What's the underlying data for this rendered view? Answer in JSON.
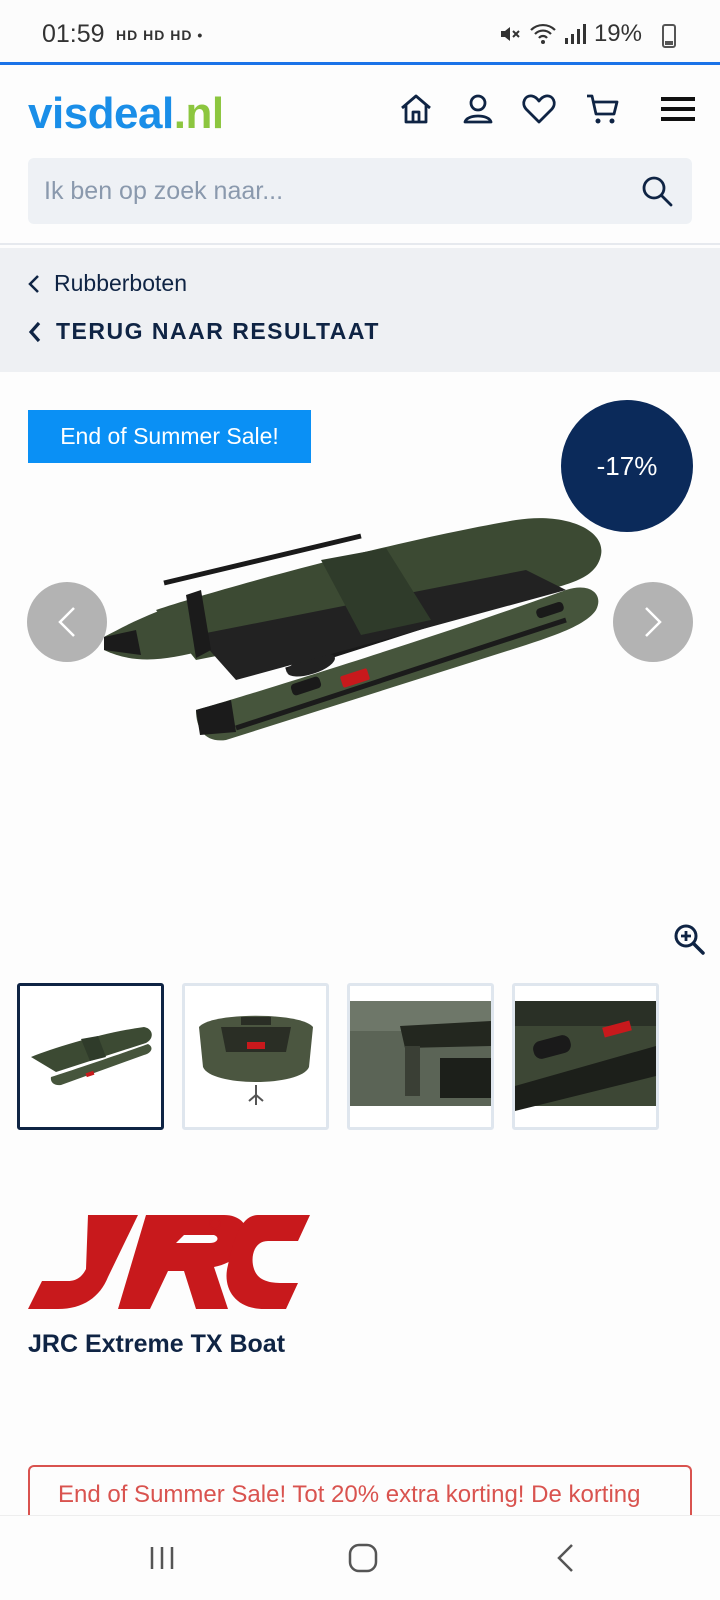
{
  "status_bar": {
    "time": "01:59",
    "indicators": "HD HD HD •",
    "battery": "19%"
  },
  "header": {
    "logo_main": "visdeal",
    "logo_dot": ".",
    "logo_tld": "nl",
    "icons": [
      "home-icon",
      "account-icon",
      "heart-icon",
      "cart-icon",
      "menu-icon"
    ]
  },
  "search": {
    "placeholder": "Ik ben op zoek naar..."
  },
  "breadcrumb": {
    "category": "Rubberboten",
    "back": "TERUG NAAR RESULTAAT"
  },
  "product": {
    "sale_badge": "End of Summer Sale!",
    "discount": "-17%",
    "title": "JRC Extreme TX Boat",
    "brand": "JRC",
    "thumbnails": [
      "boat-side",
      "boat-front",
      "boat-seat",
      "boat-handle"
    ],
    "promo_text": "End of Summer Sale! Tot 20% extra korting! De korting"
  },
  "colors": {
    "accent": "#1a8ee8",
    "logo_green": "#8cc63f",
    "navy": "#0f2444",
    "sale_blue": "#0a90f5",
    "discount_bg": "#0b2a5a",
    "promo_red": "#d9534f",
    "brand_red": "#c8191c",
    "boat_green": "#3f4d36"
  }
}
